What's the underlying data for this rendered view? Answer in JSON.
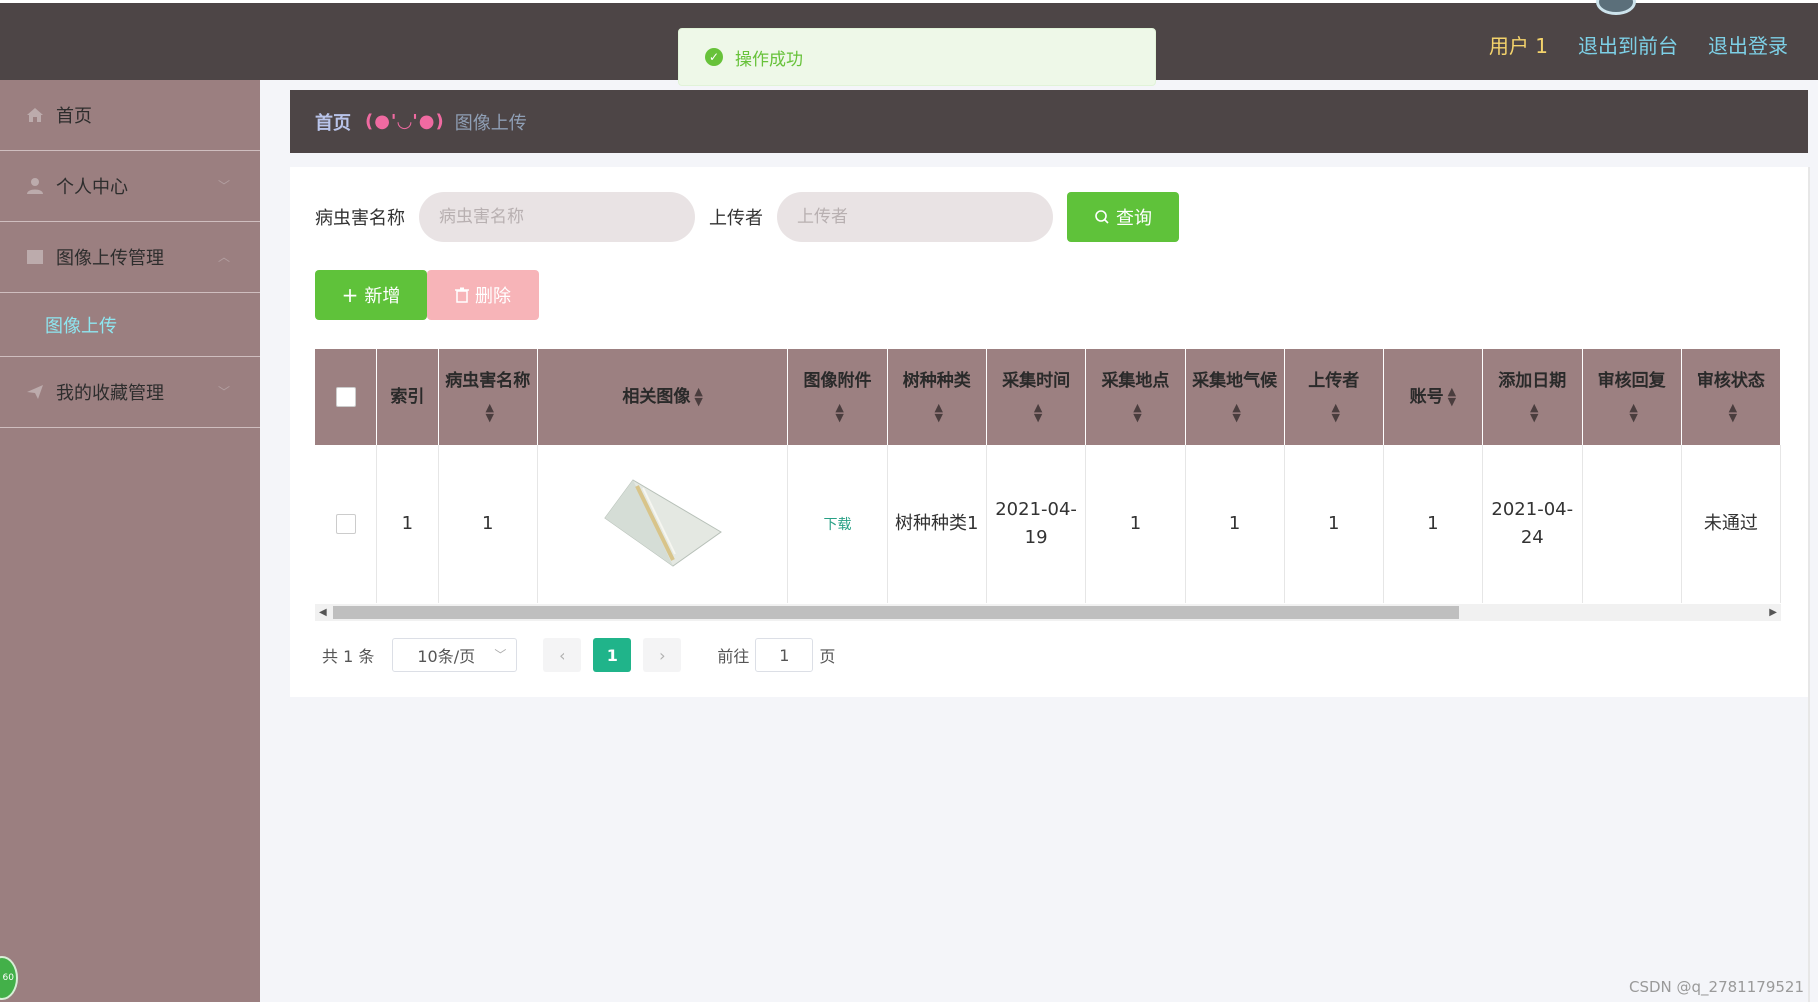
{
  "header": {
    "user": "用户 1",
    "link_frontend": "退出到前台",
    "link_logout": "退出登录"
  },
  "toast": {
    "message": "操作成功",
    "icon": "check-circle-icon"
  },
  "sidebar": {
    "items": [
      {
        "label": "首页",
        "icon": "home-icon"
      },
      {
        "label": "个人中心",
        "icon": "user-icon"
      },
      {
        "label": "图像上传管理",
        "icon": "image-icon"
      },
      {
        "label": "我的收藏管理",
        "icon": "send-icon"
      }
    ],
    "sub_active": "图像上传",
    "float_badge": "60"
  },
  "breadcrumb": {
    "home": "首页",
    "emoji": "(●'◡'●)",
    "current": "图像上传"
  },
  "search": {
    "name_label": "病虫害名称",
    "name_placeholder": "病虫害名称",
    "uploader_label": "上传者",
    "uploader_placeholder": "上传者",
    "query_button": "查询"
  },
  "actions": {
    "add": "新增",
    "delete": "删除"
  },
  "table": {
    "headers": [
      "索引",
      "病虫害名称",
      "相关图像",
      "图像附件",
      "树种种类",
      "采集时间",
      "采集地点",
      "采集地气候",
      "上传者",
      "账号",
      "添加日期",
      "审核回复",
      "审核状态"
    ],
    "rows": [
      {
        "index": "1",
        "pest_name": "1",
        "attachment": "下载",
        "tree_type": "树种种类1",
        "collect_time": "2021-04-19",
        "location": "1",
        "climate": "1",
        "uploader": "1",
        "account": "1",
        "add_date": "2021-04-24",
        "review_reply": "",
        "review_status": "未通过"
      }
    ]
  },
  "pagination": {
    "total": "共 1 条",
    "page_size": "10条/页",
    "current": "1",
    "goto_label": "前往",
    "goto_value": "1",
    "page_suffix": "页"
  },
  "watermark": "CSDN @q_2781179521",
  "colors": {
    "topbar": "#4d4546",
    "sidebar": "#9b7f80",
    "table_header": "#9c8081",
    "primary_green": "#5fc23a",
    "danger_pink": "#f7b4b8",
    "page_active": "#20b48a"
  }
}
